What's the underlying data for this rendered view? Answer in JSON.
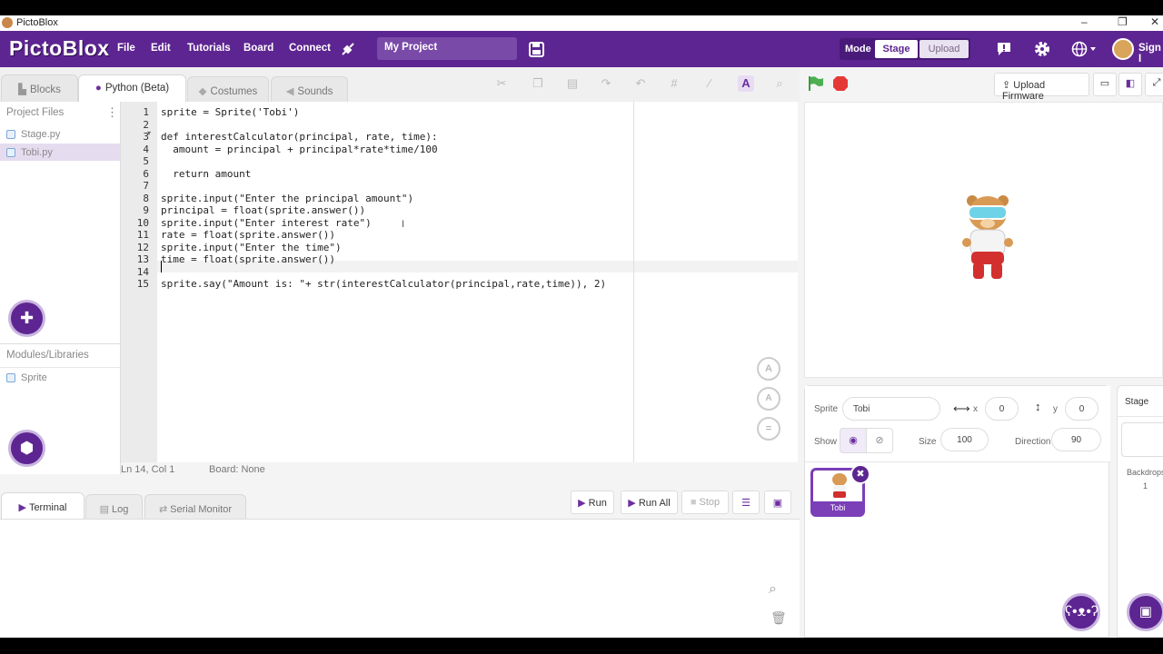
{
  "window": {
    "title": "PictoBlox",
    "controls": [
      "–",
      "❐",
      "✕"
    ]
  },
  "menubar": {
    "brand": "PictoBlox",
    "items": [
      "File",
      "Edit",
      "Tutorials",
      "Board",
      "Connect"
    ],
    "project_name": "My Project",
    "mode_label": "Mode",
    "mode_stage": "Stage",
    "mode_upload": "Upload",
    "sign_in": "Sign I"
  },
  "tabs": {
    "blocks": "Blocks",
    "python": "Python (Beta)",
    "costumes": "Costumes",
    "sounds": "Sounds"
  },
  "sidebar": {
    "project_files": "Project Files",
    "files": [
      "Stage.py",
      "Tobi.py"
    ],
    "modules": "Modules/Libraries",
    "module_items": [
      "Sprite"
    ]
  },
  "editor": {
    "lines": [
      "sprite = Sprite('Tobi')",
      "",
      "def interestCalculator(principal, rate, time):",
      "  amount = principal + principal*rate*time/100",
      "",
      "  return amount",
      "",
      "sprite.input(\"Enter the principal amount\")",
      "principal = float(sprite.answer())",
      "sprite.input(\"Enter interest rate\")",
      "rate = float(sprite.answer())",
      "sprite.input(\"Enter the time\")",
      "time = float(sprite.answer())",
      "",
      "sprite.say(\"Amount is: \"+ str(interestCalculator(principal,rate,time)), 2)"
    ],
    "line_numbers": [
      "1",
      "2",
      "3",
      "4",
      "5",
      "6",
      "7",
      "8",
      "9",
      "10",
      "11",
      "12",
      "13",
      "14",
      "15"
    ],
    "status_pos": "Ln 14, Col 1",
    "status_board": "Board: None"
  },
  "bottom": {
    "tab_terminal": "Terminal",
    "tab_log": "Log",
    "tab_serial": "Serial Monitor",
    "run": "Run",
    "run_all": "Run All",
    "stop": "Stop"
  },
  "right": {
    "upload_firmware": "Upload Firmware",
    "sprite_label": "Sprite",
    "sprite_name": "Tobi",
    "x_label": "x",
    "x_value": "0",
    "y_label": "y",
    "y_value": "0",
    "show_label": "Show",
    "size_label": "Size",
    "size_value": "100",
    "direction_label": "Direction",
    "direction_value": "90",
    "thumb_name": "Tobi",
    "stage_tab": "Stage",
    "backdrops_label": "Backdrops",
    "backdrops_count": "1"
  },
  "colors": {
    "brand": "#5d2591",
    "accent_light": "#c9b5e0",
    "green_flag": "#4caf50",
    "stop": "#e53935"
  }
}
